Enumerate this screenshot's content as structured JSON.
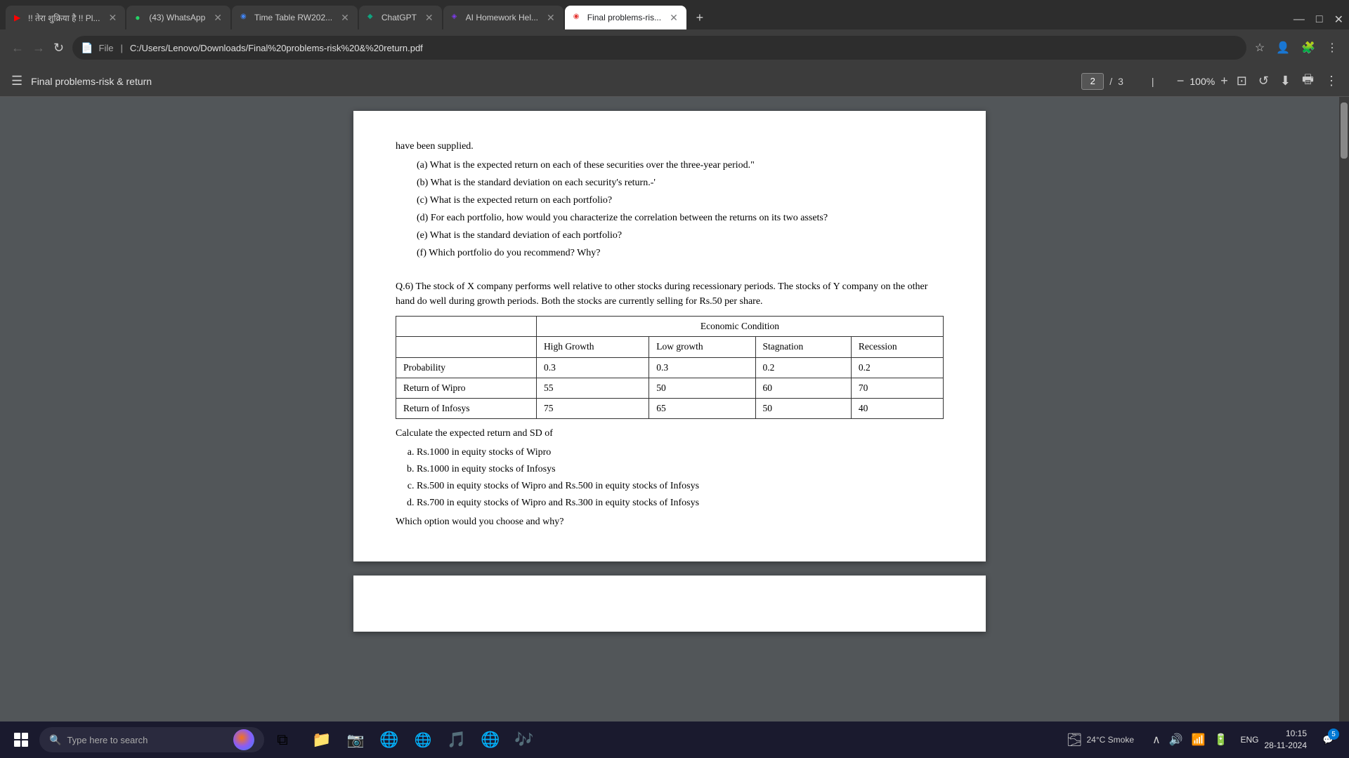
{
  "browser": {
    "tabs": [
      {
        "id": "tab1",
        "favicon": "▶",
        "favicon_class": "fav-yt",
        "title": "!! तेरा शुक्रिया है !! Pl...",
        "active": false
      },
      {
        "id": "tab2",
        "favicon": "●",
        "favicon_class": "fav-wa",
        "title": "(43) WhatsApp",
        "active": false
      },
      {
        "id": "tab3",
        "favicon": "◉",
        "favicon_class": "fav-tt",
        "title": "Time Table RW202...",
        "active": false
      },
      {
        "id": "tab4",
        "favicon": "◆",
        "favicon_class": "fav-gpt",
        "title": "ChatGPT",
        "active": false
      },
      {
        "id": "tab5",
        "favicon": "◈",
        "favicon_class": "fav-ai",
        "title": "AI Homework Hel...",
        "active": false
      },
      {
        "id": "tab6",
        "favicon": "◉",
        "favicon_class": "fav-pdf",
        "title": "Final problems-ris...",
        "active": true
      }
    ],
    "url": "C:/Users/Lenovo/Downloads/Final%20problems-risk%20&%20return.pdf",
    "url_protocol": "File",
    "new_tab_label": "+",
    "win_minimize": "—",
    "win_maximize": "□",
    "win_close": "✕"
  },
  "pdf": {
    "title": "Final problems-risk & return",
    "current_page": "2",
    "total_pages": "3",
    "zoom": "100%",
    "separator": "/"
  },
  "content": {
    "intro_lines": [
      "have been supplied.",
      "(a)   What is the expected return on each of these securities over the three-year period.\"",
      "(b)   What is the standard deviation on each security's return.-'",
      "(c)        What is the expected return on each portfolio?",
      "(d)   For each portfolio, how would you characterize the correlation between the returns on its two assets?",
      "(e)        What is the standard deviation of each portfolio?",
      "(f)        Which portfolio do you recommend? Why?"
    ],
    "q6": {
      "text": "Q.6) The stock of X company performs well relative to other stocks during recessionary periods. The stocks of Y company on the other hand do well during growth periods. Both the stocks are currently selling for Rs.50 per share.",
      "table": {
        "header1": "Economic Condition",
        "col_headers": [
          "",
          "High Growth",
          "Low growth",
          "Stagnation",
          "Recession"
        ],
        "rows": [
          {
            "label": "Probability",
            "hg": "0.3",
            "lg": "0.3",
            "st": "0.2",
            "rc": "0.2"
          },
          {
            "label": "Return of Wipro",
            "hg": "55",
            "lg": "50",
            "st": "60",
            "rc": "70"
          },
          {
            "label": "Return of Infosys",
            "hg": "75",
            "lg": "65",
            "st": "50",
            "rc": "40"
          }
        ]
      },
      "calc_intro": "Calculate the expected return  and SD of",
      "calc_items": [
        "Rs.1000 in equity stocks of Wipro",
        "Rs.1000 in equity stocks of Infosys",
        "Rs.500 in equity stocks of Wipro and Rs.500 in equity stocks of Infosys",
        "Rs.700 in equity stocks of Wipro and Rs.300 in equity stocks of Infosys"
      ],
      "conclusion": "Which option would you choose and why?"
    }
  },
  "taskbar": {
    "search_placeholder": "Type here to search",
    "apps": [
      {
        "name": "task-view",
        "icon": "⧉"
      },
      {
        "name": "file-explorer",
        "icon": "📁"
      },
      {
        "name": "chrome",
        "icon": "🌐"
      },
      {
        "name": "spotify",
        "icon": "🎵"
      },
      {
        "name": "chrome-alt",
        "icon": "🌐"
      },
      {
        "name": "spotify-alt",
        "icon": "🎵"
      }
    ],
    "weather": "24°C Smoke",
    "weather_icon": "🌫",
    "sys_icons": [
      "∧",
      "🔊",
      "📡",
      "🔋"
    ],
    "time": "10:15",
    "date": "28-11-2024",
    "lang": "ENG",
    "notif_count": "5"
  }
}
